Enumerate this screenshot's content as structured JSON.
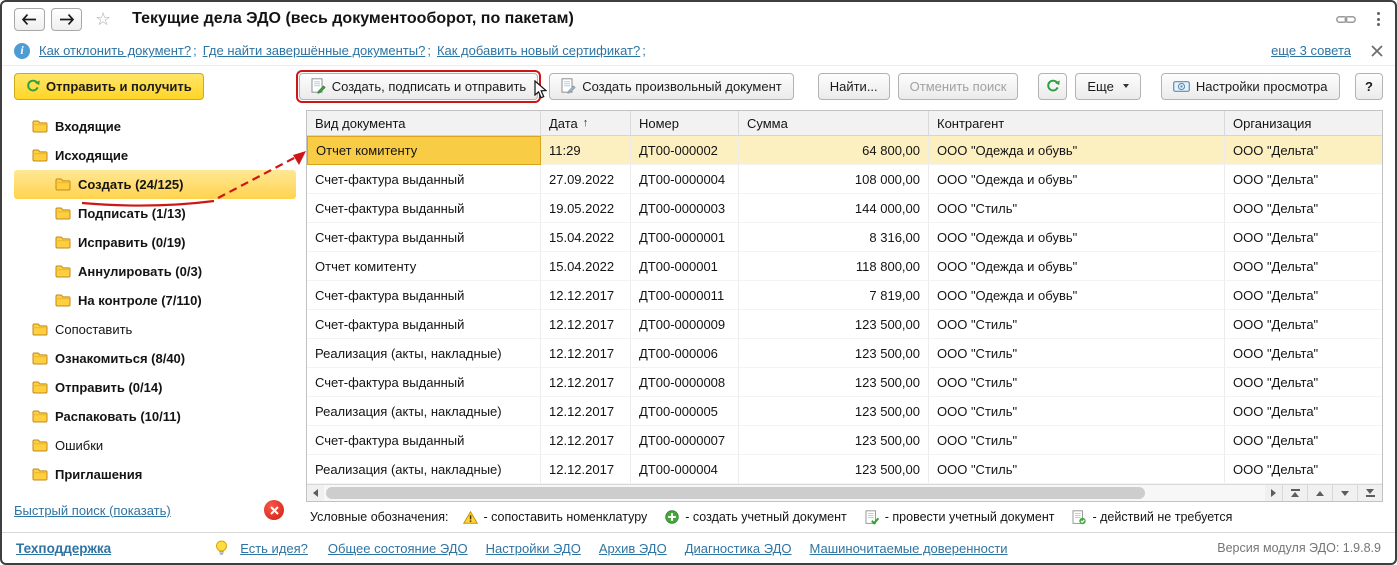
{
  "colors": {
    "accent_yellow": "#FFD527",
    "selection_strong": "#F8CC45",
    "selection_soft": "#FCEFC0",
    "link": "#2E74A3",
    "annotation_red": "#CF1616"
  },
  "window": {
    "title": "Текущие дела ЭДО (весь документооборот, по пакетам)"
  },
  "infobar": {
    "links": [
      "Как отклонить документ?",
      "Где найти завершённые документы?",
      "Как добавить новый сертификат?"
    ],
    "more_link": "еще 3 совета"
  },
  "toolbar": {
    "send_receive": "Отправить и получить",
    "create_sign_send": "Создать, подписать и отправить",
    "create_arbitrary": "Создать произвольный документ",
    "find": "Найти...",
    "cancel_search": "Отменить поиск",
    "more": "Еще",
    "view_settings": "Настройки просмотра",
    "help": "?"
  },
  "sidebar": {
    "items": [
      {
        "label": "Входящие",
        "level": 0,
        "bold": true
      },
      {
        "label": "Исходящие",
        "level": 0,
        "bold": true
      },
      {
        "label": "Создать (24/125)",
        "level": 1,
        "bold": true,
        "selected": true
      },
      {
        "label": "Подписать (1/13)",
        "level": 1,
        "bold": true
      },
      {
        "label": "Исправить (0/19)",
        "level": 1,
        "bold": true
      },
      {
        "label": "Аннулировать (0/3)",
        "level": 1,
        "bold": true
      },
      {
        "label": "На контроле (7/110)",
        "level": 1,
        "bold": true
      },
      {
        "label": "Сопоставить",
        "level": 0,
        "bold": false
      },
      {
        "label": "Ознакомиться (8/40)",
        "level": 0,
        "bold": true
      },
      {
        "label": "Отправить (0/14)",
        "level": 0,
        "bold": true
      },
      {
        "label": "Распаковать (10/11)",
        "level": 0,
        "bold": true
      },
      {
        "label": "Ошибки",
        "level": 0,
        "bold": false
      },
      {
        "label": "Приглашения",
        "level": 0,
        "bold": true
      }
    ],
    "quick_search": "Быстрый поиск (показать)"
  },
  "table": {
    "columns": [
      {
        "label": "Вид документа"
      },
      {
        "label": "Дата",
        "sort": "asc"
      },
      {
        "label": "Номер"
      },
      {
        "label": "Сумма"
      },
      {
        "label": "Контрагент"
      },
      {
        "label": "Организация"
      }
    ],
    "rows": [
      {
        "doc_type": "Отчет комитенту",
        "date": "11:29",
        "number": "ДТ00-000002",
        "amount": "64 800,00",
        "counterparty": "ООО \"Одежда и обувь\"",
        "organization": "ООО \"Дельта\"",
        "selected": true
      },
      {
        "doc_type": "Счет-фактура выданный",
        "date": "27.09.2022",
        "number": "ДТ00-0000004",
        "amount": "108 000,00",
        "counterparty": "ООО \"Одежда и обувь\"",
        "organization": "ООО \"Дельта\""
      },
      {
        "doc_type": "Счет-фактура выданный",
        "date": "19.05.2022",
        "number": "ДТ00-0000003",
        "amount": "144 000,00",
        "counterparty": "ООО \"Стиль\"",
        "organization": "ООО \"Дельта\""
      },
      {
        "doc_type": "Счет-фактура выданный",
        "date": "15.04.2022",
        "number": "ДТ00-0000001",
        "amount": "8 316,00",
        "counterparty": "ООО \"Одежда и обувь\"",
        "organization": "ООО \"Дельта\""
      },
      {
        "doc_type": "Отчет комитенту",
        "date": "15.04.2022",
        "number": "ДТ00-000001",
        "amount": "118 800,00",
        "counterparty": "ООО \"Одежда и обувь\"",
        "organization": "ООО \"Дельта\""
      },
      {
        "doc_type": "Счет-фактура выданный",
        "date": "12.12.2017",
        "number": "ДТ00-0000011",
        "amount": "7 819,00",
        "counterparty": "ООО \"Одежда и обувь\"",
        "organization": "ООО \"Дельта\""
      },
      {
        "doc_type": "Счет-фактура выданный",
        "date": "12.12.2017",
        "number": "ДТ00-0000009",
        "amount": "123 500,00",
        "counterparty": "ООО \"Стиль\"",
        "organization": "ООО \"Дельта\""
      },
      {
        "doc_type": "Реализация (акты, накладные)",
        "date": "12.12.2017",
        "number": "ДТ00-000006",
        "amount": "123 500,00",
        "counterparty": "ООО \"Стиль\"",
        "organization": "ООО \"Дельта\""
      },
      {
        "doc_type": "Счет-фактура выданный",
        "date": "12.12.2017",
        "number": "ДТ00-0000008",
        "amount": "123 500,00",
        "counterparty": "ООО \"Стиль\"",
        "organization": "ООО \"Дельта\""
      },
      {
        "doc_type": "Реализация (акты, накладные)",
        "date": "12.12.2017",
        "number": "ДТ00-000005",
        "amount": "123 500,00",
        "counterparty": "ООО \"Стиль\"",
        "organization": "ООО \"Дельта\""
      },
      {
        "doc_type": "Счет-фактура выданный",
        "date": "12.12.2017",
        "number": "ДТ00-0000007",
        "amount": "123 500,00",
        "counterparty": "ООО \"Стиль\"",
        "organization": "ООО \"Дельта\""
      },
      {
        "doc_type": "Реализация (акты, накладные)",
        "date": "12.12.2017",
        "number": "ДТ00-000004",
        "amount": "123 500,00",
        "counterparty": "ООО \"Стиль\"",
        "organization": "ООО \"Дельта\""
      }
    ]
  },
  "legend": {
    "label": "Условные обозначения:",
    "items": [
      {
        "icon": "warning-icon",
        "text": "- сопоставить номенклатуру"
      },
      {
        "icon": "plus-icon",
        "text": "- создать учетный документ"
      },
      {
        "icon": "doc-post-icon",
        "text": "- провести учетный документ"
      },
      {
        "icon": "doc-ok-icon",
        "text": "- действий не требуется"
      }
    ]
  },
  "footer": {
    "support": "Техподдержка",
    "idea": "Есть идея?",
    "links": [
      "Общее состояние ЭДО",
      "Настройки ЭДО",
      "Архив ЭДО",
      "Диагностика ЭДО",
      "Машиночитаемые доверенности"
    ],
    "version": "Версия модуля ЭДО: 1.9.8.9"
  }
}
